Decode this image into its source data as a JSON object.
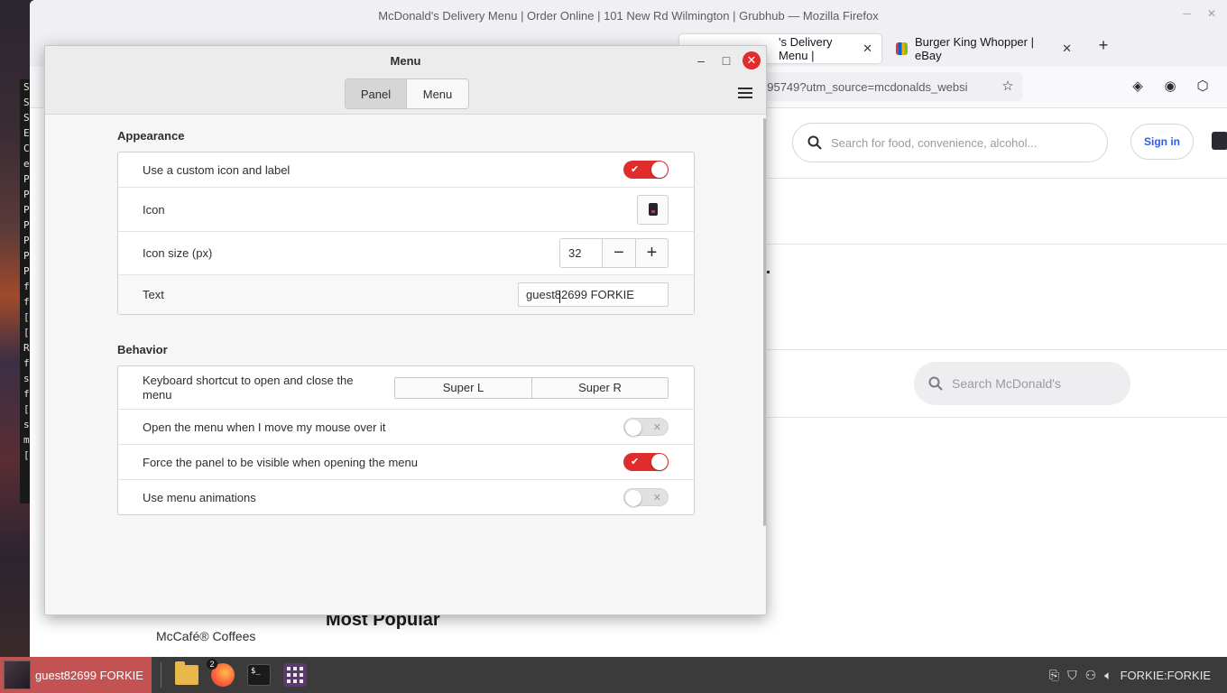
{
  "browser": {
    "window_title": "McDonald's Delivery Menu | Order Online | 101 New Rd Wilmington | Grubhub — Mozilla Firefox",
    "tabs": [
      {
        "label": "'s Delivery Menu |",
        "active": true
      },
      {
        "label": "Burger King Whopper | eBay",
        "active": false
      }
    ],
    "url_fragment": "095749?utm_source=mcdonalds_websi"
  },
  "page": {
    "search_placeholder": "Search for food, convenience, alcohol...",
    "sign_in": "Sign in",
    "store_search_placeholder": "Search McDonald's",
    "section_heading": "Most Popular",
    "category_item": "McCafé® Coffees"
  },
  "terminal_peek": [
    "S",
    "S",
    "S",
    "E",
    "C",
    "e",
    "P",
    "P",
    "P",
    "P",
    "P",
    "P",
    "P",
    "f",
    "f",
    "[",
    "[",
    "R",
    "f",
    "s",
    "f",
    "[",
    "s",
    "m",
    "["
  ],
  "dialog": {
    "title": "Menu",
    "tabs": [
      {
        "label": "Panel",
        "selected": true
      },
      {
        "label": "Menu",
        "selected": false
      }
    ],
    "appearance": {
      "title": "Appearance",
      "custom_icon_label": "Use a custom icon and label",
      "custom_icon_on": true,
      "icon_label": "Icon",
      "icon_size_label": "Icon size (px)",
      "icon_size_value": "32",
      "text_label": "Text",
      "text_value": "guest82699 FORKIE"
    },
    "behavior": {
      "title": "Behavior",
      "shortcut_label": "Keyboard shortcut to open and close the menu",
      "shortcut_left": "Super L",
      "shortcut_right": "Super R",
      "hover_label": "Open the menu when I move my mouse over it",
      "hover_on": false,
      "force_panel_label": "Force the panel to be visible when opening the menu",
      "force_panel_on": true,
      "animations_label": "Use menu animations",
      "animations_on": false
    }
  },
  "taskbar": {
    "user_label": "guest82699 FORKIE",
    "firefox_badge": "2",
    "tray_label": "FORKIE:FORKIE"
  },
  "colors": {
    "accent_red": "#df2c2c",
    "user_applet": "#c35353",
    "taskbar": "#3b3b3b"
  }
}
